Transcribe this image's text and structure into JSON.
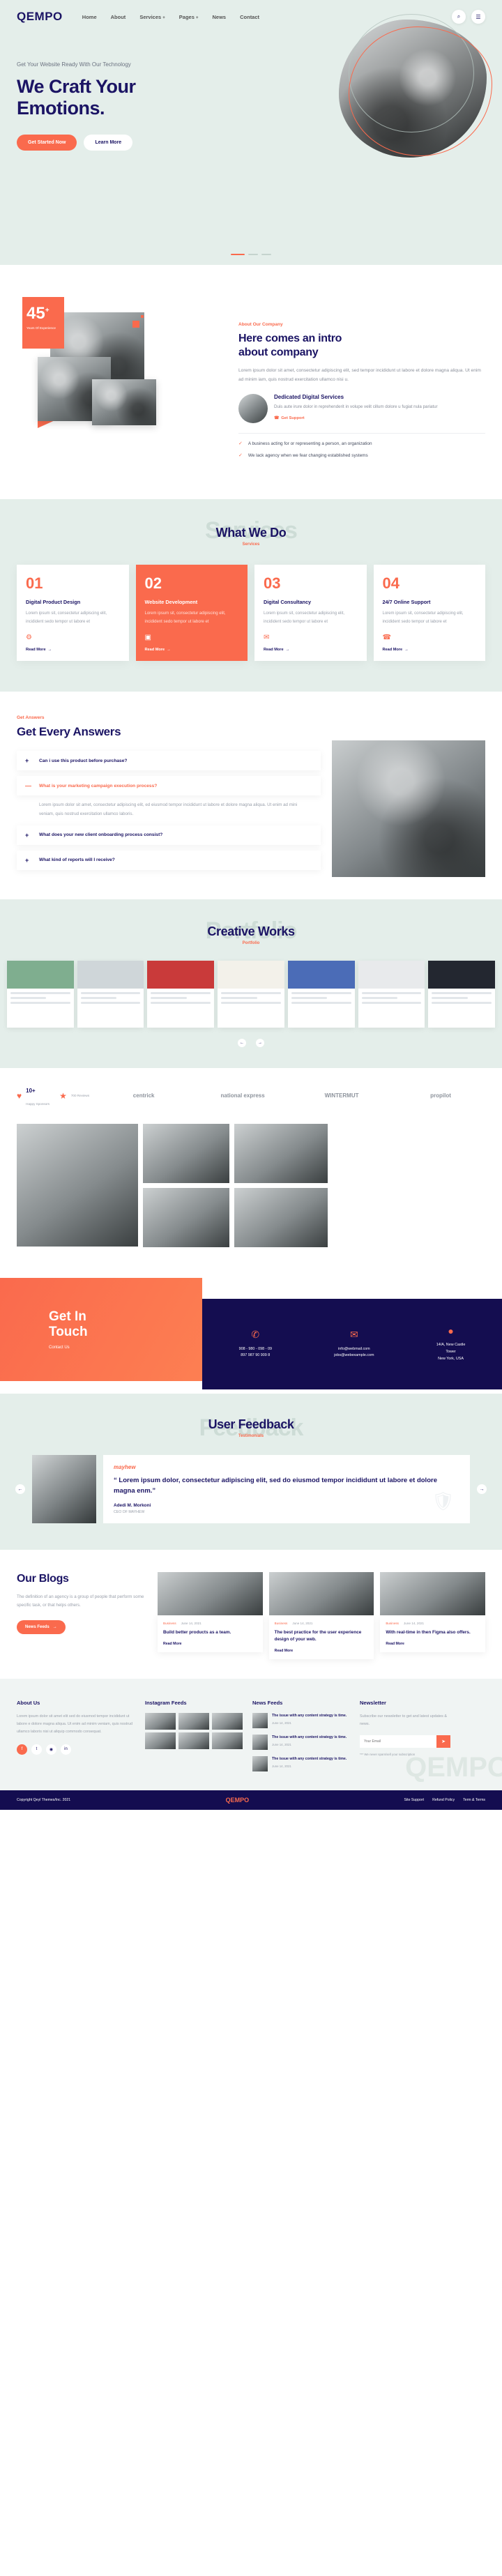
{
  "header": {
    "logo": "QEMPO",
    "menu": [
      {
        "label": "Home",
        "caret": ""
      },
      {
        "label": "About",
        "caret": ""
      },
      {
        "label": "Services",
        "caret": "+"
      },
      {
        "label": "Pages",
        "caret": "+"
      },
      {
        "label": "News",
        "caret": ""
      },
      {
        "label": "Contact",
        "caret": ""
      }
    ],
    "search_icon": "⌕",
    "menu_icon": "☰"
  },
  "hero": {
    "tagline": "Get Your Website Ready With Our Technology",
    "title_line1": "We Craft Your",
    "title_line2": "Emotions.",
    "primary_button": "Get Started Now",
    "secondary_button": "Learn More"
  },
  "about": {
    "stat_number": "45",
    "stat_plus": "+",
    "stat_label": "Years Of Experience",
    "eyebrow": "About Our Company",
    "title_line1": "Here comes an intro",
    "title_line2": "about company",
    "paragraph": "Lorem ipsum dolor sit amet, consectetur adipiscing elit, sed tempor incididunt ut labore et dolore magna aliqua. Ut enim ad minim iam, quis nostrud exercitation ullamco nisi u.",
    "dedicated_title": "Dedicated Digital Services",
    "dedicated_text": "Duis aute irure dolor in reprehenderit in volupe velit cillum dolore u fugiat nula pariatur",
    "support_link": "Get Support",
    "support_icon": "headset-icon",
    "checks": [
      "A business acting for or representing a person, an organization",
      "We lack agency when we fear changing established systems"
    ]
  },
  "services": {
    "ghost": "Services",
    "title": "What We Do",
    "subtitle": "Services",
    "cards": [
      {
        "num": "01",
        "title": "Digital Product Design",
        "text": "Lorem ipsum sit, consectetur adipiscing elit, incidident sedo tempor ut labore et",
        "icon": "gear-icon",
        "more": "Read More"
      },
      {
        "num": "02",
        "title": "Website Development",
        "text": "Lorem ipsum sit, consectetur adipiscing elit, incidident sedo tempor ut labore et",
        "icon": "browser-icon",
        "more": "Read More"
      },
      {
        "num": "03",
        "title": "Digital Consultancy",
        "text": "Lorem ipsum sit, consectetur adipiscing elit, incidident sedo tempor ut labore et",
        "icon": "chat-icon",
        "more": "Read More"
      },
      {
        "num": "04",
        "title": "24/7 Online Support",
        "text": "Lorem ipsum sit, consectetur adipiscing elit, incidident sedo tempor ut labore et",
        "icon": "support-icon",
        "more": "Read More"
      }
    ]
  },
  "faq": {
    "eyebrow": "Get Answers",
    "title": "Get Every Answers",
    "items": [
      {
        "q": "Can i use this product before purchase?",
        "sign": "+",
        "open": false,
        "body": ""
      },
      {
        "q": "What is your marketing campaign execution process?",
        "sign": "—",
        "open": true,
        "body": "Lorem ipsum dolor sit amet, consectetur adipiscing elit, ed eiusmod tempor incididunt ut labore et dolore magna aliqua. Ut enim ad mini veniam, quis nostrud exercitation ullamco laboris."
      },
      {
        "q": "What does your new client onboarding process consist?",
        "sign": "+",
        "open": false,
        "body": ""
      },
      {
        "q": "What kind of reports will I receive?",
        "sign": "+",
        "open": false,
        "body": ""
      }
    ]
  },
  "portfolio": {
    "ghost": "Portfolio",
    "title": "Creative Works",
    "subtitle": "Portfolio",
    "prev_icon": "chevron-left-icon",
    "next_icon": "chevron-right-icon",
    "items": [
      {
        "accent": "#7fae8f"
      },
      {
        "accent": "#cfd6d9"
      },
      {
        "accent": "#c93a3a"
      },
      {
        "accent": "#f3f1ea"
      },
      {
        "accent": "#4b6cb7"
      },
      {
        "accent": "#e8eaec"
      },
      {
        "accent": "#232730"
      }
    ]
  },
  "clients": {
    "stat_number": "10+",
    "stat_label": "Happy Sponsors",
    "rating_label": "700 Reviews",
    "logos": [
      "centrick",
      "national express",
      "WINTERMUT",
      "propilot"
    ]
  },
  "contact": {
    "title_line1": "Get In",
    "title_line2": "Touch",
    "subtitle": "Contact Us",
    "blocks": [
      {
        "icon": "phone-icon",
        "lines": [
          "908 - 980 - 098 - 09",
          "897 987 90 909 8"
        ]
      },
      {
        "icon": "mail-icon",
        "lines": [
          "info@webmail.com",
          "jobs@webexample.com"
        ]
      },
      {
        "icon": "location-icon",
        "lines": [
          "14/A, New Castle",
          "Tower",
          "New York, USA"
        ]
      }
    ]
  },
  "feedback": {
    "ghost": "Feedback",
    "title": "User Feedback",
    "subtitle": "Testimonials",
    "brand": "mayhew",
    "quote": "“ Lorem ipsum dolor, consectetur adipiscing elit, sed do eiusmod tempor incididunt ut labore et dolore magna enm.”",
    "name": "Adedi M. Morkoni",
    "role": "CEO OF MAYHEW",
    "prev_icon": "chevron-left-icon",
    "next_icon": "chevron-right-icon"
  },
  "blog": {
    "title": "Our Blogs",
    "intro": "The definition of an agency is a group of people that perform some specific task, or that helps others.",
    "button": "News Feeds",
    "posts": [
      {
        "cat": "Business",
        "date": "June 14, 2021",
        "title": "Build better products as a team.",
        "more": "Read More"
      },
      {
        "cat": "Business",
        "date": "June 14, 2021",
        "title": "The best practice for the user experience design of your web.",
        "more": "Read More"
      },
      {
        "cat": "Business",
        "date": "June 14, 2021",
        "title": "With real-time in then Figma also offers.",
        "more": "Read More"
      }
    ]
  },
  "footer": {
    "about_title": "About Us",
    "about_text": "Lorem ipsum dolor sit amet elit sed do eiusmod tempor incididunt ut labore e dolore magna aliqua. Ut enim ad minim veniam, quis nostrud  ullamco laboris nisi ut aliquip commodo consequat.",
    "socials": [
      "facebook-icon",
      "twitter-icon",
      "instagram-icon",
      "linkedin-icon"
    ],
    "instagram_title": "Instagram Feeds",
    "news_title": "News Feeds",
    "news_items": [
      {
        "title": "The issue with any content strategy is time.",
        "date": "June 14, 2021"
      },
      {
        "title": "The issue with any content strategy is time.",
        "date": "June 14, 2021"
      },
      {
        "title": "The issue with any content strategy is time.",
        "date": "June 14, 2021"
      }
    ],
    "newsletter_title": "Newsletter",
    "newsletter_text": "Subscribe our newsletter to get and latest updates & news.",
    "newsletter_placeholder": "Your Email",
    "newsletter_button": "send-icon",
    "newsletter_note": "*** We never spam/sell your subscription",
    "ghost": "QEMPO"
  },
  "copyright": {
    "text": "Copyright Qeyl Themes/Inc. 2021",
    "brand": "QEMPO",
    "links": [
      "Site Support",
      "Refund Policy",
      "Term & Terms"
    ]
  }
}
